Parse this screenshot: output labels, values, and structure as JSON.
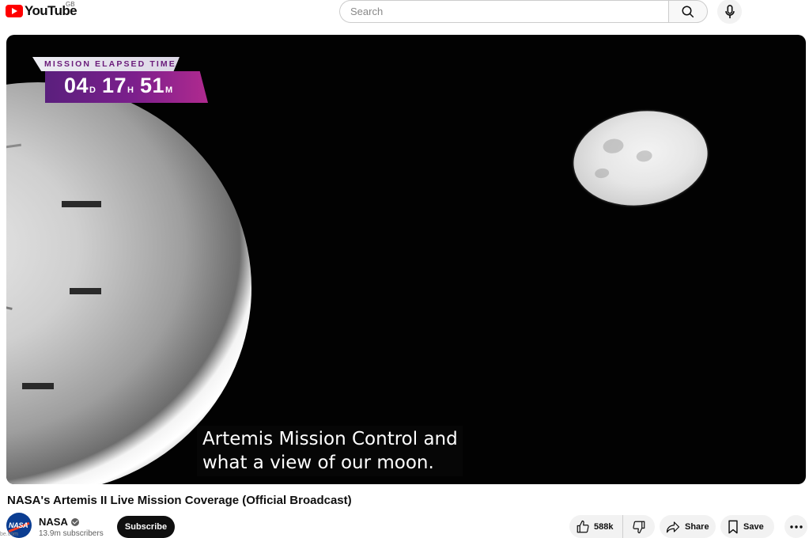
{
  "header": {
    "logo_text": "YouTube",
    "country_code": "GB",
    "search_placeholder": "Search",
    "brand_color": "#ff0000"
  },
  "player": {
    "overlay": {
      "label": "MISSION ELAPSED TIME",
      "days": "04",
      "days_unit": "D",
      "hours": "17",
      "hours_unit": "H",
      "minutes": "51",
      "minutes_unit": "M",
      "accent_color": "#7c1f8c"
    },
    "caption": {
      "line1": "Artemis Mission Control and",
      "line2": "what a view of our moon."
    }
  },
  "video": {
    "title": "NASA's Artemis II Live Mission Coverage (Official Broadcast)"
  },
  "channel": {
    "name": "NASA",
    "avatar_text": "NASA",
    "subscribers": "13.9m subscribers",
    "subscribe_label": "Subscribe"
  },
  "actions": {
    "like_count": "588k",
    "share_label": "Share",
    "save_label": "Save"
  },
  "misc": {
    "edge_text": "be.com"
  }
}
